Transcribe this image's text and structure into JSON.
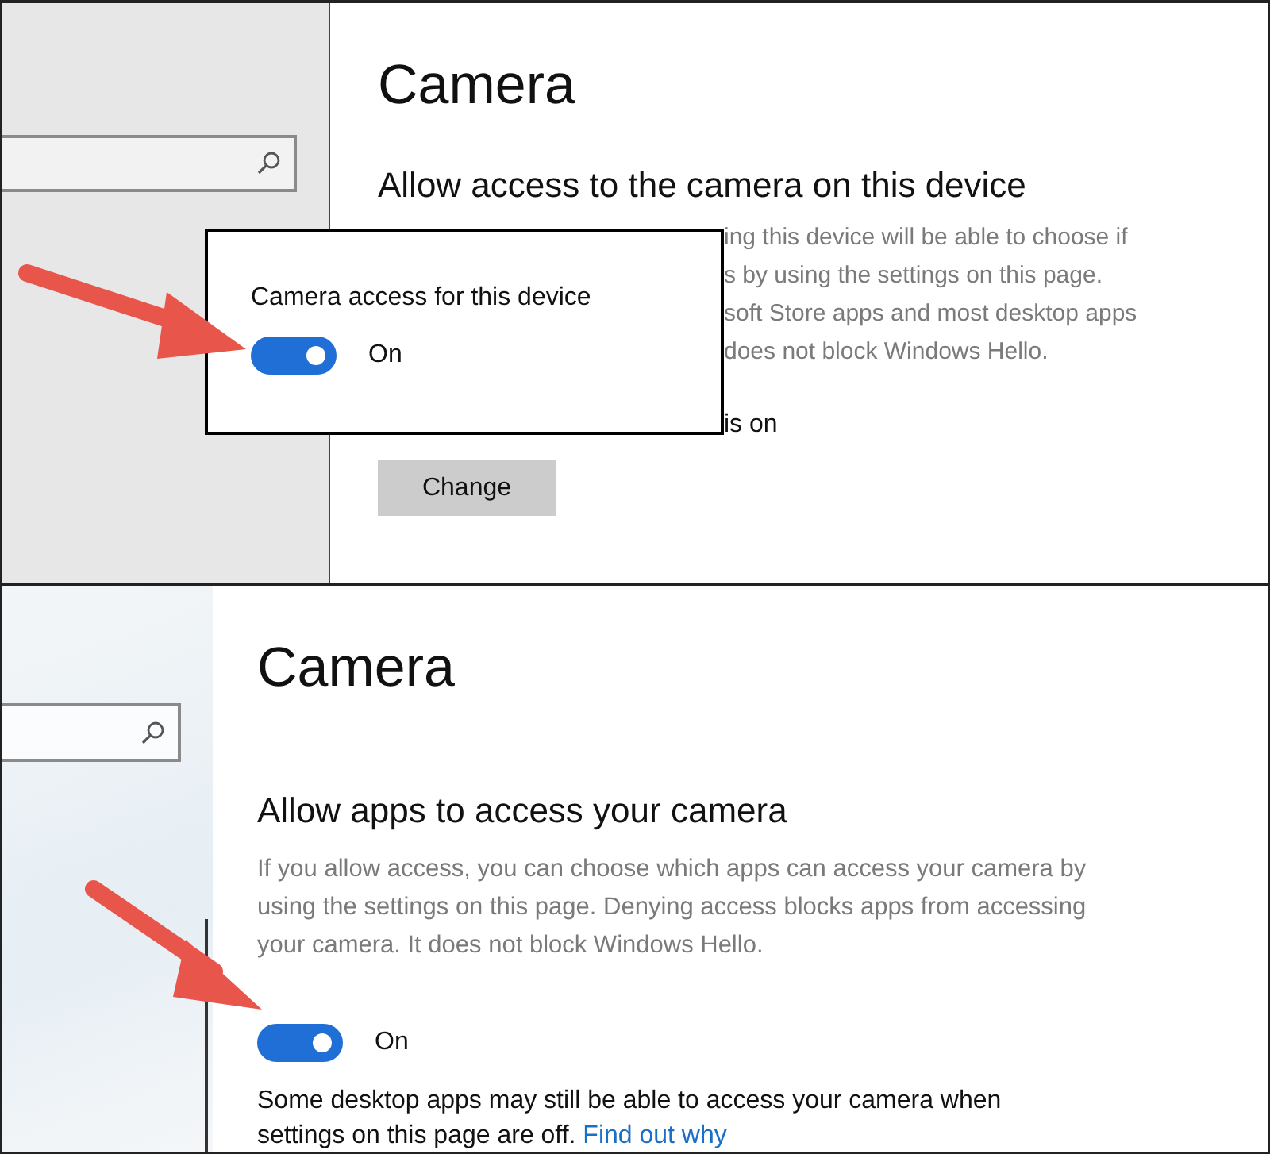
{
  "device_panel": {
    "title": "Camera",
    "heading": "Allow access to the camera on this device",
    "description_fragments": [
      "ing this device will be able to choose if",
      "s by using the settings on this page.",
      "soft Store apps and most desktop apps",
      "does not block Windows Hello."
    ],
    "status_fragment": "is on",
    "popup": {
      "label": "Camera access for this device",
      "toggle": {
        "on": true,
        "label": "On"
      }
    },
    "button": "Change"
  },
  "apps_panel": {
    "title": "Camera",
    "heading": "Allow apps to access your camera",
    "description": "If you allow access, you can choose which apps can access your camera by using the settings on this page. Denying access blocks apps from accessing your camera. It does not block Windows Hello.",
    "toggle": {
      "on": true,
      "label": "On"
    },
    "note": "Some desktop apps may still be able to access your camera when settings on this page are off.",
    "link": "Find out why"
  }
}
